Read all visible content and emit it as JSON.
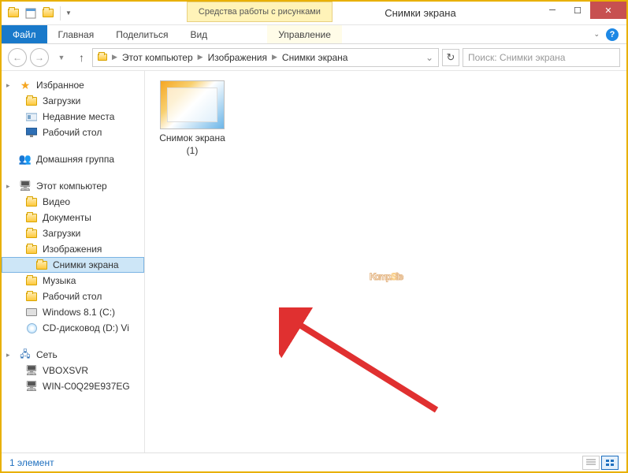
{
  "titlebar": {
    "context_tab": "Средства работы с рисунками",
    "title": "Снимки экрана"
  },
  "ribbon": {
    "file": "Файл",
    "tabs": [
      "Главная",
      "Поделиться",
      "Вид"
    ],
    "context": "Управление"
  },
  "address": {
    "segments": [
      "Этот компьютер",
      "Изображения",
      "Снимки экрана"
    ]
  },
  "search": {
    "placeholder": "Поиск: Снимки экрана"
  },
  "sidebar": {
    "favorites": {
      "label": "Избранное",
      "items": [
        "Загрузки",
        "Недавние места",
        "Рабочий стол"
      ]
    },
    "homegroup": "Домашняя группа",
    "computer": {
      "label": "Этот компьютер",
      "items": [
        "Видео",
        "Документы",
        "Загрузки",
        "Изображения"
      ],
      "selected": "Снимки экрана",
      "items2": [
        "Музыка",
        "Рабочий стол",
        "Windows 8.1 (C:)",
        "CD-дисковод (D:) Vi"
      ]
    },
    "network": {
      "label": "Сеть",
      "items": [
        "VBOXSVR",
        "WIN-C0Q29E937EG"
      ]
    }
  },
  "content": {
    "file1": {
      "name": "Снимок экрана (1)"
    }
  },
  "watermark": {
    "part1": "Komp.",
    "part2": "S",
    "part3": "ite"
  },
  "statusbar": {
    "count": "1 элемент"
  }
}
